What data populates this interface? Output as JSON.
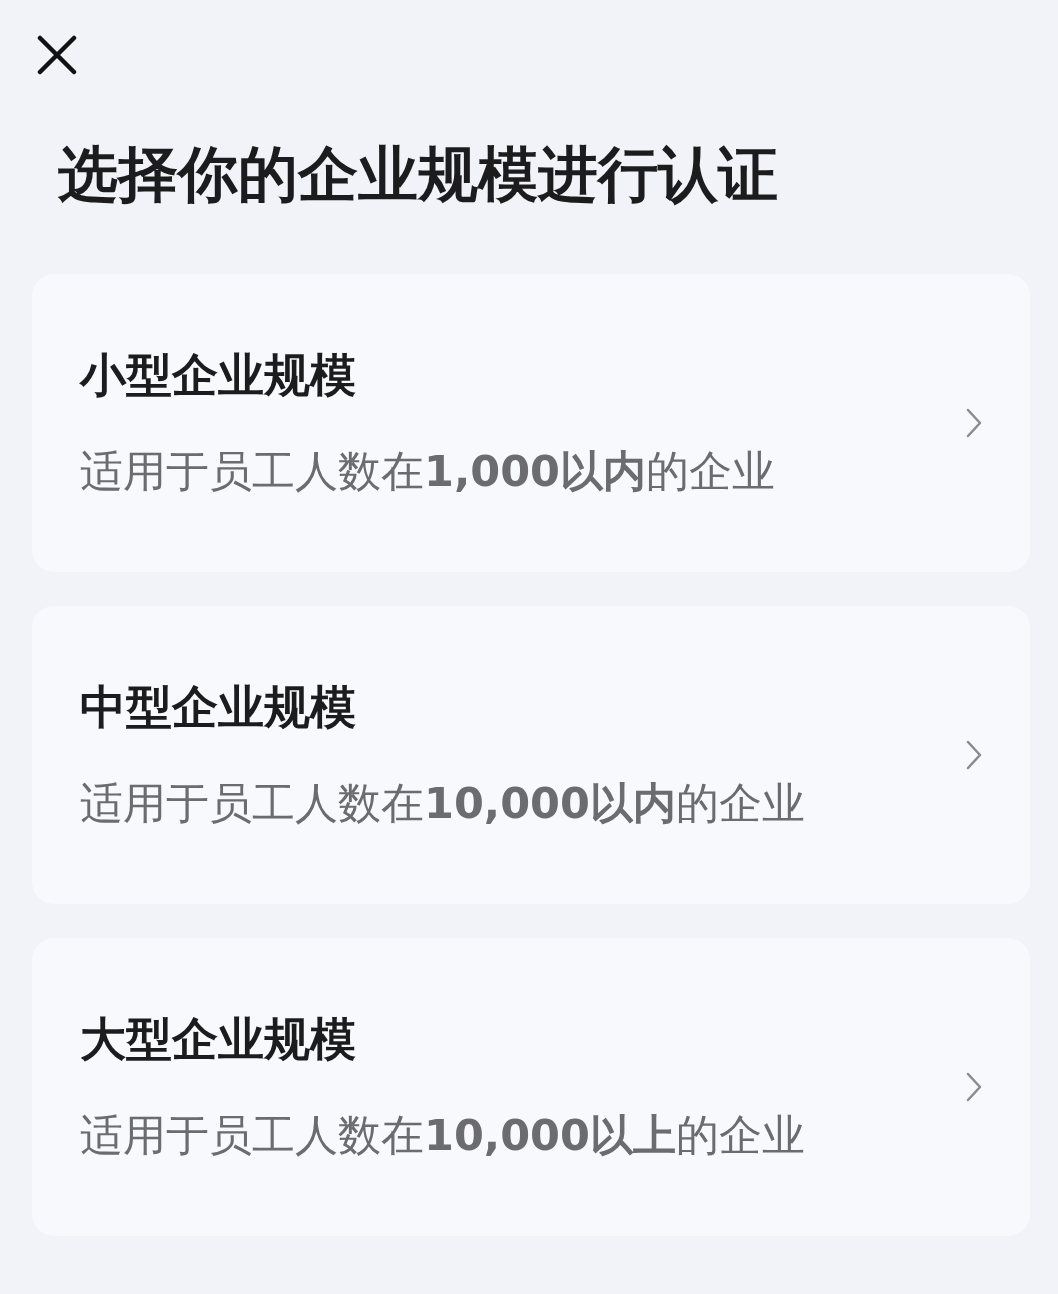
{
  "title": "选择你的企业规模进行认证",
  "options": [
    {
      "name": "小型企业规模",
      "description": "适用于员工人数在**1,000以内**的企业"
    },
    {
      "name": "中型企业规模",
      "description": "适用于员工人数在**10,000以内**的企业"
    },
    {
      "name": "大型企业规模",
      "description": "适用于员工人数在**10,000以上**的企业"
    }
  ]
}
